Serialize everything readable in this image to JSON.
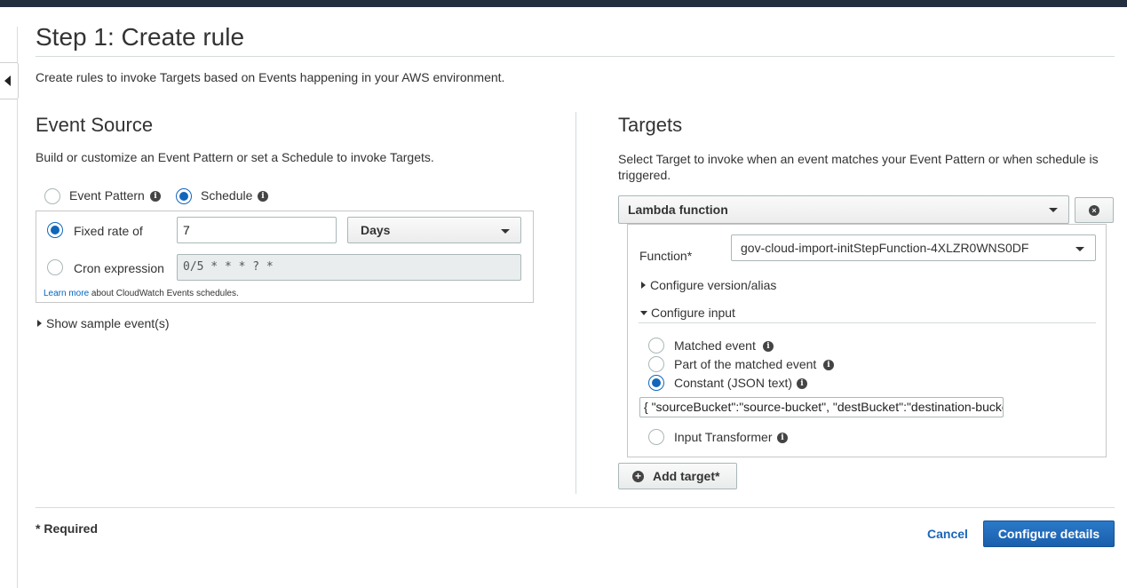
{
  "page": {
    "title": "Step 1: Create rule",
    "description": "Create rules to invoke Targets based on Events happening in your AWS environment."
  },
  "event_source": {
    "heading": "Event Source",
    "description": "Build or customize an Event Pattern or set a Schedule to invoke Targets.",
    "event_pattern_label": "Event Pattern",
    "schedule_label": "Schedule",
    "selected_source": "Schedule",
    "fixed_rate_label": "Fixed rate of",
    "fixed_rate_value": "7",
    "rate_unit": "Days",
    "cron_label": "Cron expression",
    "cron_placeholder": "0/5 * * * ? *",
    "learn_more_link": "Learn more",
    "learn_more_text": " about CloudWatch Events schedules.",
    "show_sample": "Show sample event(s)"
  },
  "targets": {
    "heading": "Targets",
    "description": "Select Target to invoke when an event matches your Event Pattern or when schedule is triggered.",
    "target_type": "Lambda function",
    "function_label": "Function*",
    "function_value": "gov-cloud-import-initStepFunction-4XLZR0WNS0DF",
    "configure_version": "Configure version/alias",
    "configure_input": "Configure input",
    "options": {
      "matched_event": "Matched event",
      "part_matched": "Part of the matched event",
      "constant_json": "Constant (JSON text)",
      "input_transformer": "Input Transformer"
    },
    "selected_option": "Constant (JSON text)",
    "constant_value": "{ \"sourceBucket\":\"source-bucket\", \"destBucket\":\"destination-bucket\" }",
    "add_target": "Add target*"
  },
  "footer": {
    "required_note": "* Required",
    "cancel": "Cancel",
    "configure_details": "Configure details"
  },
  "colors": {
    "primary": "#1a66b8",
    "link": "#0066c0",
    "topbar": "#232f3e"
  }
}
